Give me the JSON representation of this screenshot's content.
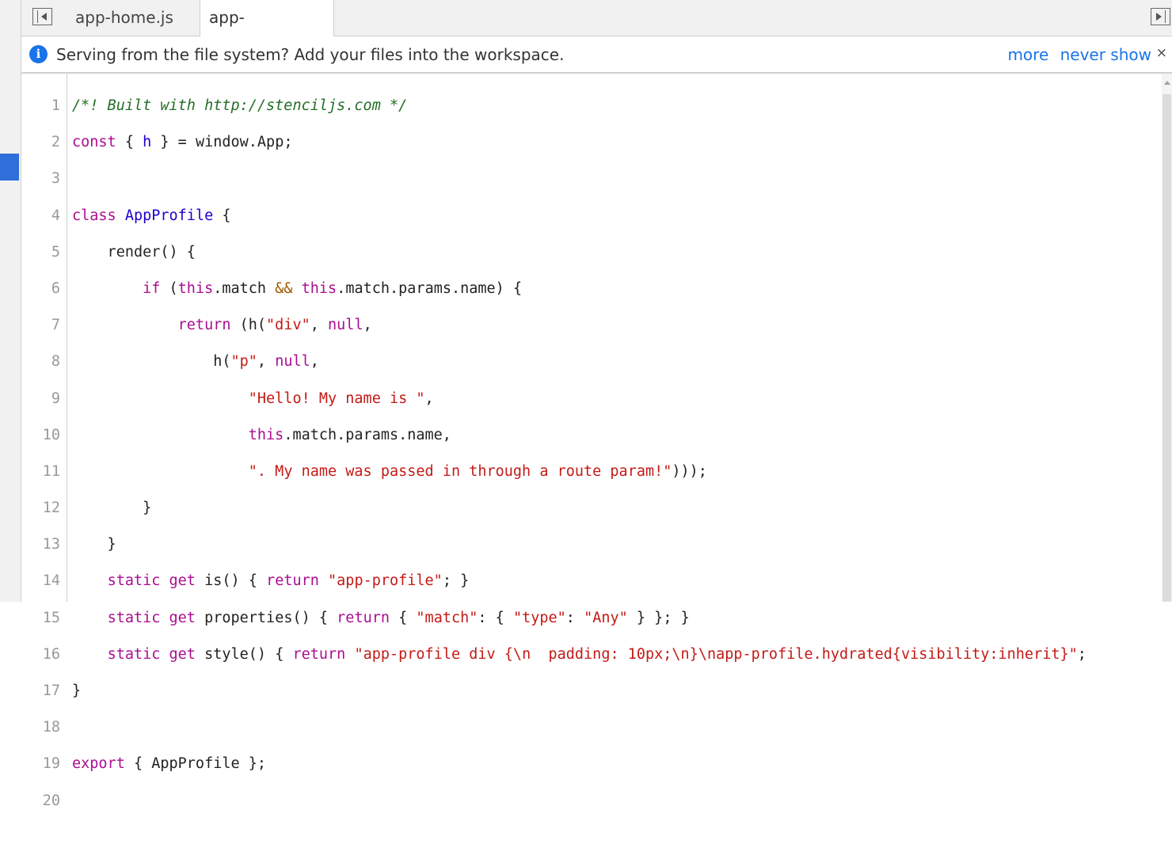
{
  "tabs": [
    {
      "label": "app-home.js",
      "active": false
    },
    {
      "label": "app-profile.js",
      "active": true,
      "close": "×"
    }
  ],
  "infobar": {
    "icon": "i",
    "message": "Serving from the file system? Add your files into the workspace.",
    "more": "more",
    "never_show": "never show",
    "close": "×"
  },
  "code": {
    "line_numbers": [
      "1",
      "2",
      "3",
      "4",
      "5",
      "6",
      "7",
      "8",
      "9",
      "10",
      "11",
      "12",
      "13",
      "14",
      "15",
      "16",
      "17",
      "18",
      "19",
      "20"
    ]
  },
  "colors": {
    "accent": "#1a73e8",
    "keyword": "#aa0d91",
    "string": "#c41a16",
    "comment": "#236e25"
  }
}
